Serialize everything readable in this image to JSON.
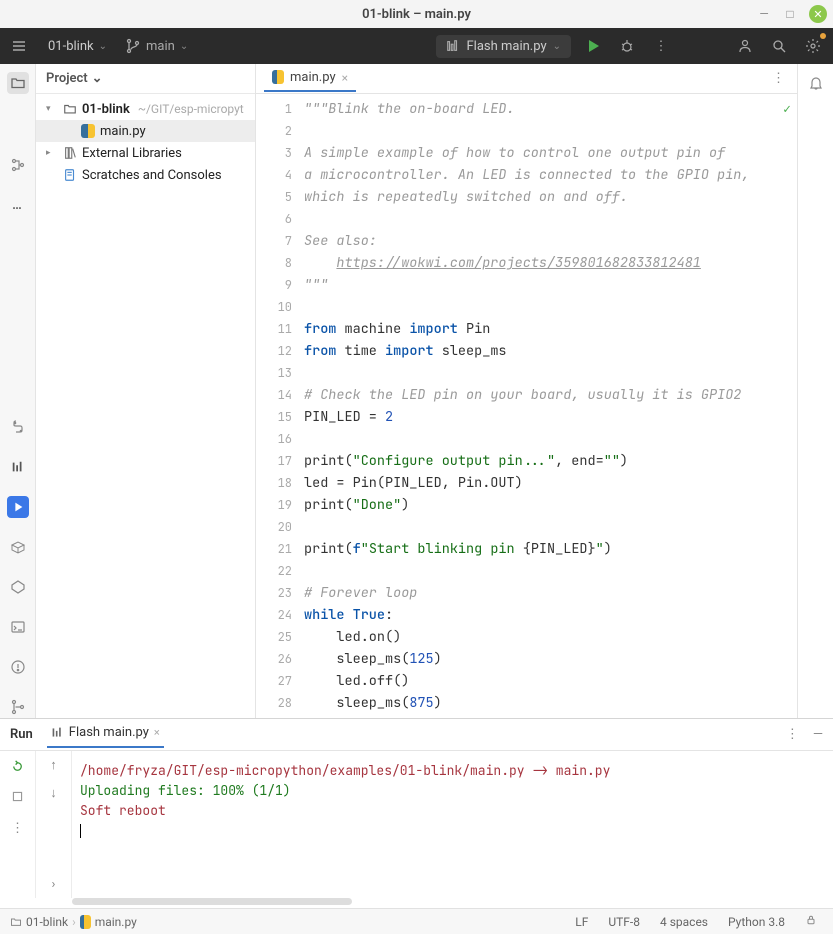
{
  "window": {
    "title": "01-blink – main.py"
  },
  "toolbar": {
    "project": "01-blink",
    "branch": "main",
    "run_config": "Flash main.py"
  },
  "project_panel": {
    "title": "Project",
    "root": {
      "label": "01-blink",
      "hint": "~/GIT/esp-micropyt"
    },
    "file": {
      "label": "main.py"
    },
    "external": "External Libraries",
    "scratches": "Scratches and Consoles"
  },
  "editor": {
    "tab_label": "main.py",
    "lines": [
      {
        "n": 1,
        "tokens": [
          {
            "cls": "s-com",
            "t": "\"\"\"Blink the on-board LED."
          }
        ]
      },
      {
        "n": 2,
        "tokens": []
      },
      {
        "n": 3,
        "tokens": [
          {
            "cls": "s-com",
            "t": "A simple example of how to control one output pin of"
          }
        ]
      },
      {
        "n": 4,
        "tokens": [
          {
            "cls": "s-com",
            "t": "a microcontroller. An LED is connected to the GPIO pin,"
          }
        ]
      },
      {
        "n": 5,
        "tokens": [
          {
            "cls": "s-com",
            "t": "which is repeatedly switched on and off."
          }
        ]
      },
      {
        "n": 6,
        "tokens": []
      },
      {
        "n": 7,
        "tokens": [
          {
            "cls": "s-com",
            "t": "See also:"
          }
        ]
      },
      {
        "n": 8,
        "tokens": [
          {
            "cls": "s-com",
            "t": "    "
          },
          {
            "cls": "s-url",
            "t": "https://wokwi.com/projects/359801682833812481"
          }
        ]
      },
      {
        "n": 9,
        "tokens": [
          {
            "cls": "s-com",
            "t": "\"\"\""
          }
        ]
      },
      {
        "n": 10,
        "tokens": []
      },
      {
        "n": 11,
        "tokens": [
          {
            "cls": "s-kw",
            "t": "from"
          },
          {
            "cls": "",
            "t": " machine "
          },
          {
            "cls": "s-kw",
            "t": "import"
          },
          {
            "cls": "",
            "t": " Pin"
          }
        ]
      },
      {
        "n": 12,
        "tokens": [
          {
            "cls": "s-kw",
            "t": "from"
          },
          {
            "cls": "",
            "t": " time "
          },
          {
            "cls": "s-kw",
            "t": "import"
          },
          {
            "cls": "",
            "t": " sleep_ms"
          }
        ]
      },
      {
        "n": 13,
        "tokens": []
      },
      {
        "n": 14,
        "tokens": [
          {
            "cls": "s-com",
            "t": "# Check the LED pin on your board, usually it is GPIO2"
          }
        ]
      },
      {
        "n": 15,
        "tokens": [
          {
            "cls": "",
            "t": "PIN_LED = "
          },
          {
            "cls": "s-num",
            "t": "2"
          }
        ]
      },
      {
        "n": 16,
        "tokens": []
      },
      {
        "n": 17,
        "tokens": [
          {
            "cls": "",
            "t": "print("
          },
          {
            "cls": "s-str",
            "t": "\"Configure output pin...\""
          },
          {
            "cls": "",
            "t": ", end="
          },
          {
            "cls": "s-str",
            "t": "\"\""
          },
          {
            "cls": "",
            "t": ")"
          }
        ]
      },
      {
        "n": 18,
        "tokens": [
          {
            "cls": "",
            "t": "led = Pin(PIN_LED, Pin.OUT)"
          }
        ]
      },
      {
        "n": 19,
        "tokens": [
          {
            "cls": "",
            "t": "print("
          },
          {
            "cls": "s-str",
            "t": "\"Done\""
          },
          {
            "cls": "",
            "t": ")"
          }
        ]
      },
      {
        "n": 20,
        "tokens": []
      },
      {
        "n": 21,
        "tokens": [
          {
            "cls": "",
            "t": "print("
          },
          {
            "cls": "s-kw",
            "t": "f"
          },
          {
            "cls": "s-fstr",
            "t": "\"Start blinking pin "
          },
          {
            "cls": "",
            "t": "{PIN_LED}"
          },
          {
            "cls": "s-fstr",
            "t": "\""
          },
          {
            "cls": "",
            "t": ")"
          }
        ]
      },
      {
        "n": 22,
        "tokens": []
      },
      {
        "n": 23,
        "tokens": [
          {
            "cls": "s-com",
            "t": "# Forever loop"
          }
        ]
      },
      {
        "n": 24,
        "tokens": [
          {
            "cls": "s-kw",
            "t": "while"
          },
          {
            "cls": "",
            "t": " "
          },
          {
            "cls": "s-kw",
            "t": "True"
          },
          {
            "cls": "",
            "t": ":"
          }
        ]
      },
      {
        "n": 25,
        "tokens": [
          {
            "cls": "",
            "t": "    led.on()"
          }
        ]
      },
      {
        "n": 26,
        "tokens": [
          {
            "cls": "",
            "t": "    sleep_ms("
          },
          {
            "cls": "s-num",
            "t": "125"
          },
          {
            "cls": "",
            "t": ")"
          }
        ]
      },
      {
        "n": 27,
        "tokens": [
          {
            "cls": "",
            "t": "    led.off()"
          }
        ]
      },
      {
        "n": 28,
        "tokens": [
          {
            "cls": "",
            "t": "    sleep_ms("
          },
          {
            "cls": "s-num",
            "t": "875"
          },
          {
            "cls": "",
            "t": ")"
          }
        ]
      }
    ]
  },
  "run": {
    "panel_label": "Run",
    "tab_label": "Flash main.py",
    "console_lines": [
      {
        "cls": "c-path",
        "text": "/home/fryza/GIT/esp-micropython/examples/01-blink/main.py -> main.py"
      },
      {
        "cls": "c-upload",
        "text": "Uploading files: 100% (1/1)"
      },
      {
        "cls": "c-reboot",
        "text": "Soft reboot"
      }
    ]
  },
  "status": {
    "crumb_folder": "01-blink",
    "crumb_file": "main.py",
    "lineend": "LF",
    "encoding": "UTF-8",
    "indent": "4 spaces",
    "interpreter": "Python 3.8"
  }
}
